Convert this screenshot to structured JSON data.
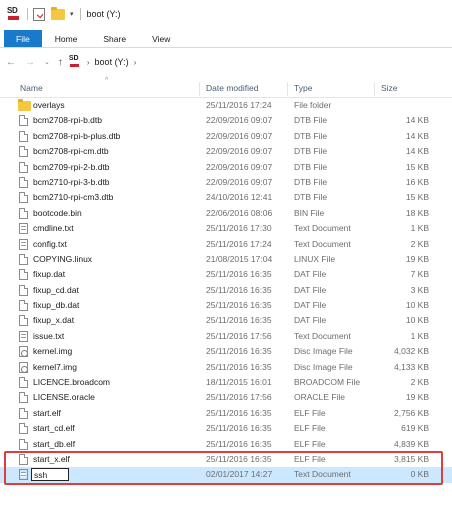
{
  "window": {
    "title": "boot (Y:)"
  },
  "quick_access": {
    "dropdown_glyph": "▾",
    "separator": "|"
  },
  "ribbon": {
    "tabs": [
      "File",
      "Home",
      "Share",
      "View"
    ]
  },
  "address": {
    "back": "←",
    "forward": "→",
    "recent": "⌄",
    "up": "↑",
    "crumb_arrow": "›",
    "drive_label": "boot (Y:)",
    "trailing_arrow": "›"
  },
  "columns": {
    "sort_indicator": "^",
    "name": "Name",
    "date": "Date modified",
    "type": "Type",
    "size": "Size"
  },
  "files": [
    {
      "icon": "folder",
      "name": "overlays",
      "date": "25/11/2016 17:24",
      "type": "File folder",
      "size": ""
    },
    {
      "icon": "file",
      "name": "bcm2708-rpi-b.dtb",
      "date": "22/09/2016 09:07",
      "type": "DTB File",
      "size": "14 KB"
    },
    {
      "icon": "file",
      "name": "bcm2708-rpi-b-plus.dtb",
      "date": "22/09/2016 09:07",
      "type": "DTB File",
      "size": "14 KB"
    },
    {
      "icon": "file",
      "name": "bcm2708-rpi-cm.dtb",
      "date": "22/09/2016 09:07",
      "type": "DTB File",
      "size": "14 KB"
    },
    {
      "icon": "file",
      "name": "bcm2709-rpi-2-b.dtb",
      "date": "22/09/2016 09:07",
      "type": "DTB File",
      "size": "15 KB"
    },
    {
      "icon": "file",
      "name": "bcm2710-rpi-3-b.dtb",
      "date": "22/09/2016 09:07",
      "type": "DTB File",
      "size": "16 KB"
    },
    {
      "icon": "file",
      "name": "bcm2710-rpi-cm3.dtb",
      "date": "24/10/2016 12:41",
      "type": "DTB File",
      "size": "15 KB"
    },
    {
      "icon": "file",
      "name": "bootcode.bin",
      "date": "22/06/2016 08:06",
      "type": "BIN File",
      "size": "18 KB"
    },
    {
      "icon": "text",
      "name": "cmdline.txt",
      "date": "25/11/2016 17:30",
      "type": "Text Document",
      "size": "1 KB"
    },
    {
      "icon": "text",
      "name": "config.txt",
      "date": "25/11/2016 17:24",
      "type": "Text Document",
      "size": "2 KB"
    },
    {
      "icon": "file",
      "name": "COPYING.linux",
      "date": "21/08/2015 17:04",
      "type": "LINUX File",
      "size": "19 KB"
    },
    {
      "icon": "file",
      "name": "fixup.dat",
      "date": "25/11/2016 16:35",
      "type": "DAT File",
      "size": "7 KB"
    },
    {
      "icon": "file",
      "name": "fixup_cd.dat",
      "date": "25/11/2016 16:35",
      "type": "DAT File",
      "size": "3 KB"
    },
    {
      "icon": "file",
      "name": "fixup_db.dat",
      "date": "25/11/2016 16:35",
      "type": "DAT File",
      "size": "10 KB"
    },
    {
      "icon": "file",
      "name": "fixup_x.dat",
      "date": "25/11/2016 16:35",
      "type": "DAT File",
      "size": "10 KB"
    },
    {
      "icon": "text",
      "name": "issue.txt",
      "date": "25/11/2016 17:56",
      "type": "Text Document",
      "size": "1 KB"
    },
    {
      "icon": "disc",
      "name": "kernel.img",
      "date": "25/11/2016 16:35",
      "type": "Disc Image File",
      "size": "4,032 KB"
    },
    {
      "icon": "disc",
      "name": "kernel7.img",
      "date": "25/11/2016 16:35",
      "type": "Disc Image File",
      "size": "4,133 KB"
    },
    {
      "icon": "file",
      "name": "LICENCE.broadcom",
      "date": "18/11/2015 16:01",
      "type": "BROADCOM File",
      "size": "2 KB"
    },
    {
      "icon": "file",
      "name": "LICENSE.oracle",
      "date": "25/11/2016 17:56",
      "type": "ORACLE File",
      "size": "19 KB"
    },
    {
      "icon": "file",
      "name": "start.elf",
      "date": "25/11/2016 16:35",
      "type": "ELF File",
      "size": "2,756 KB"
    },
    {
      "icon": "file",
      "name": "start_cd.elf",
      "date": "25/11/2016 16:35",
      "type": "ELF File",
      "size": "619 KB"
    },
    {
      "icon": "file",
      "name": "start_db.elf",
      "date": "25/11/2016 16:35",
      "type": "ELF File",
      "size": "4,839 KB"
    },
    {
      "icon": "file",
      "name": "start_x.elf",
      "date": "25/11/2016 16:35",
      "type": "ELF File",
      "size": "3,815 KB"
    },
    {
      "icon": "text",
      "name": "ssh",
      "date": "02/01/2017 14:27",
      "type": "Text Document",
      "size": "0 KB",
      "selected": true,
      "renaming": true
    }
  ],
  "colors": {
    "file_tab": "#1979ca",
    "selection": "#cce8ff",
    "annotation": "#e03c3c"
  }
}
